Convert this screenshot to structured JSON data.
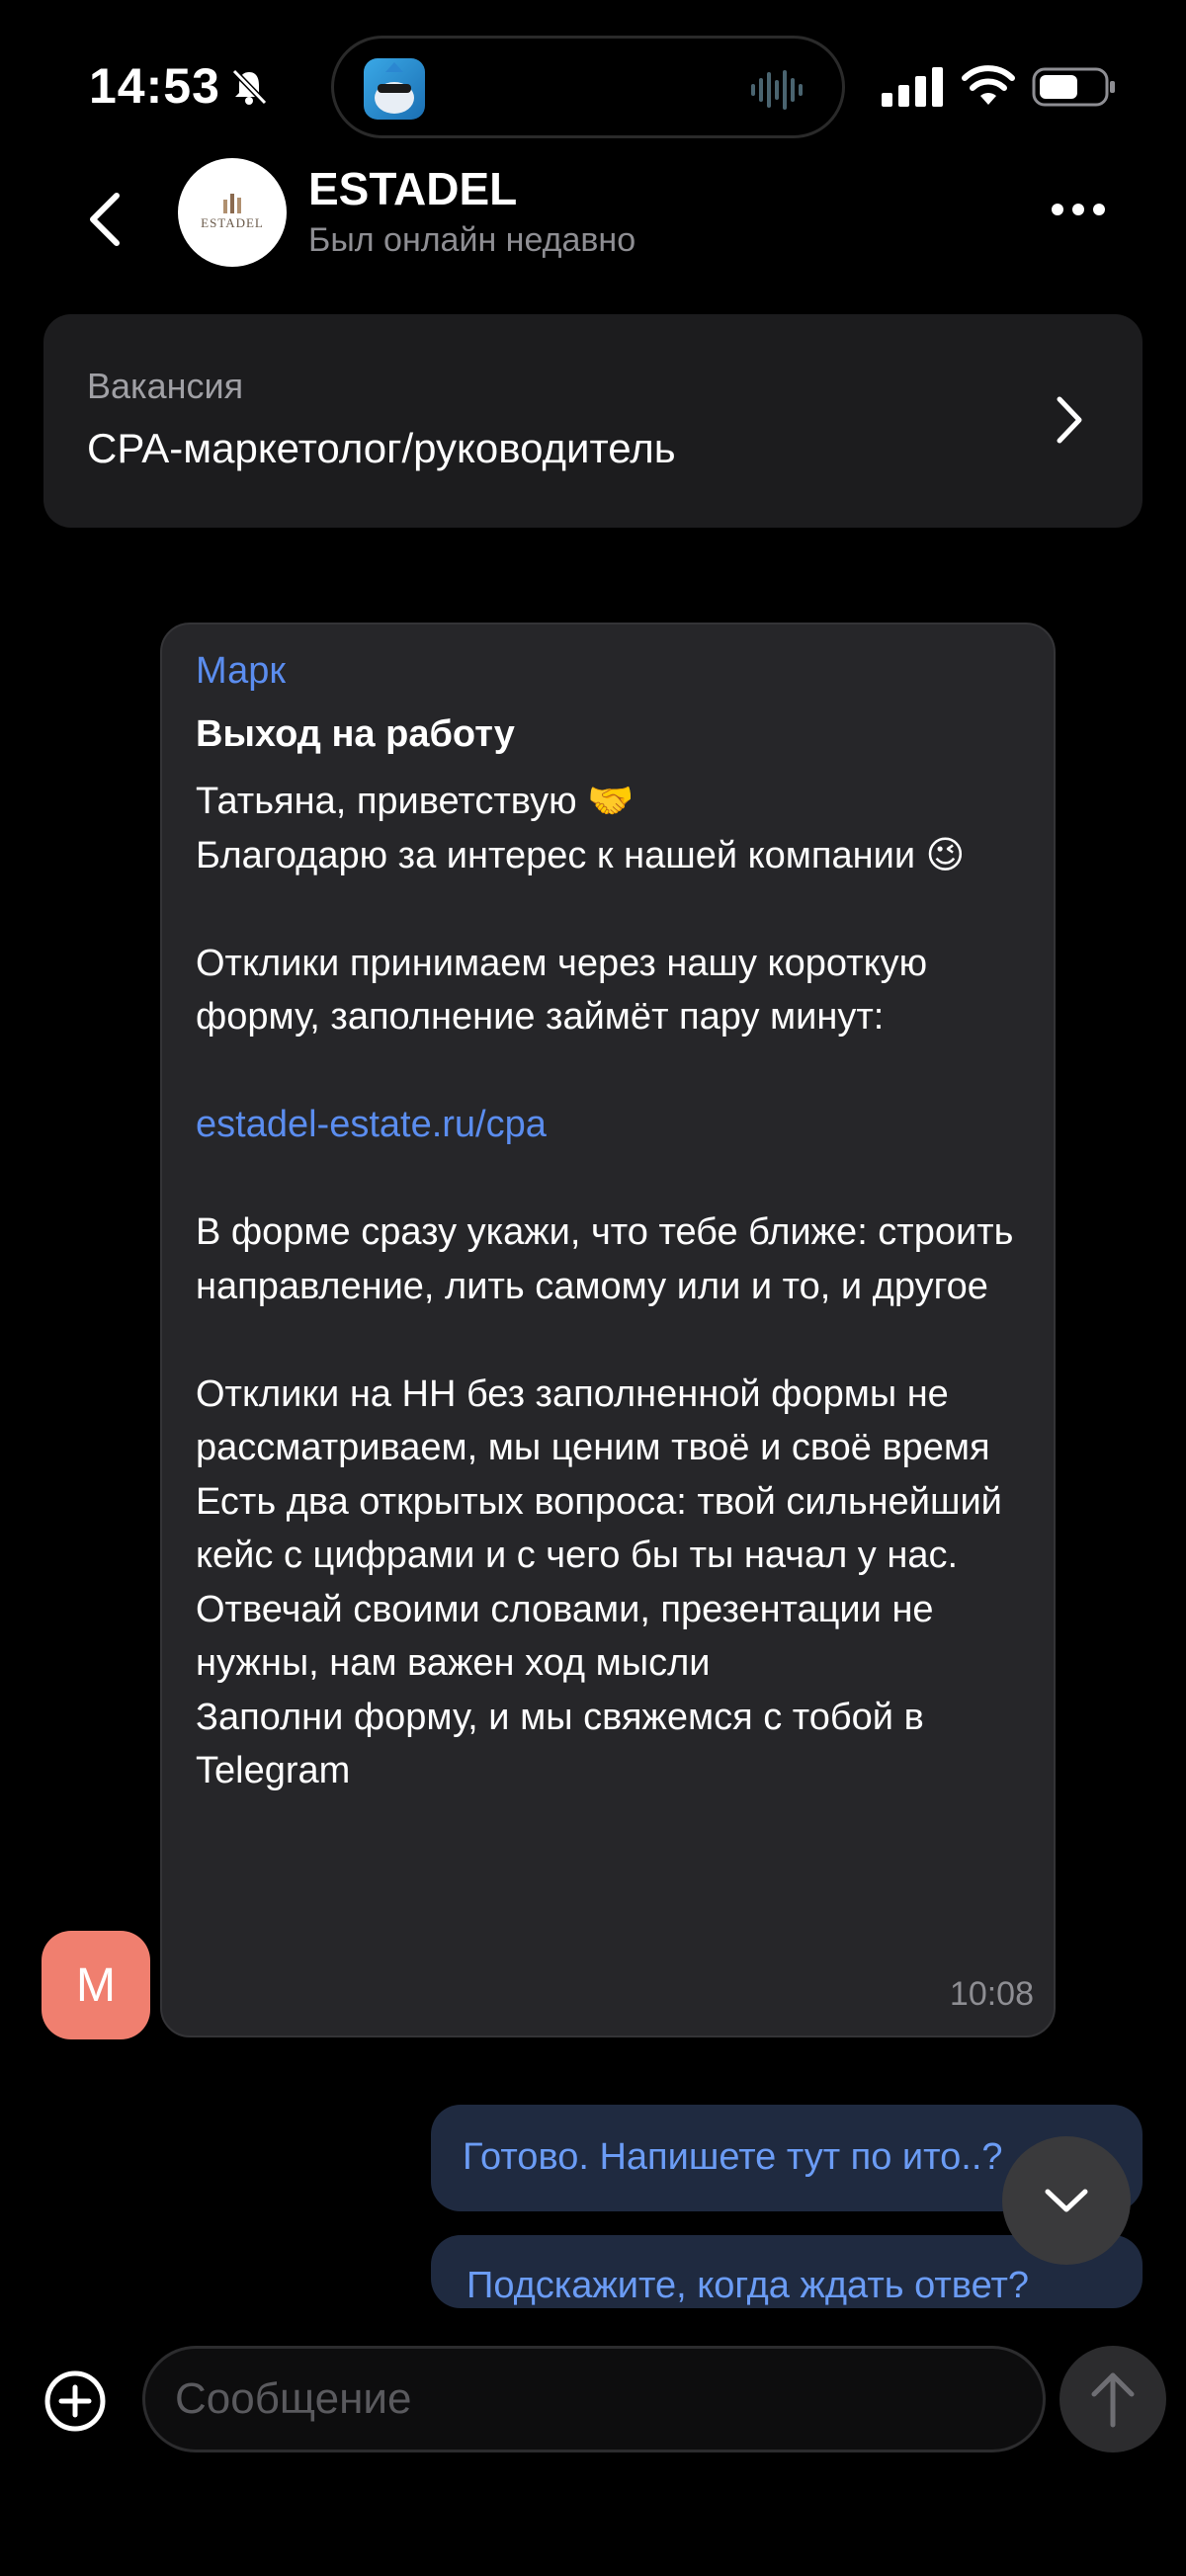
{
  "status_bar": {
    "time": "14:53",
    "icons": [
      "bell-off-icon",
      "app-icon",
      "audio-wave-icon",
      "signal-icon",
      "wifi-icon",
      "battery-icon"
    ]
  },
  "header": {
    "title": "ESTADEL",
    "subtitle": "Был онлайн недавно",
    "logo_text": "ESTADEL"
  },
  "vacancy": {
    "label": "Вакансия",
    "title": "CPA-маркетолог/руководитель"
  },
  "messages": {
    "incoming": {
      "sender": "Марк",
      "avatar_letter": "М",
      "title": "Выход на работу",
      "line1": "Татьяна, приветствую 🤝",
      "line2": "Благодарю за интерес к нашей компании 😉",
      "para2": "Отклики принимаем через нашу короткую форму, заполнение займёт пару минут:",
      "link": "estadel-estate.ru/cpa",
      "para3": "В форме сразу укажи, что тебе ближе: строить направление, лить самому или и то, и другое",
      "para4": "Отклики на HH без заполненной формы не рассматриваем, мы ценим твоё и своё время\nЕсть два открытых вопроса: твой сильнейший кейс с цифрами и с чего бы ты начал у нас.\nОтвечай своими словами, презентации не нужны, нам важен ход мысли\nЗаполни форму, и мы свяжемся с тобой в Telegram",
      "time": "10:08"
    },
    "outgoing": [
      {
        "text": "Готово. Напишете тут по ито..?"
      },
      {
        "text": "Подскажите, когда ждать ответ?"
      }
    ]
  },
  "composer": {
    "placeholder": "Сообщение"
  },
  "colors": {
    "accent": "#5b8def",
    "avatar": "#f07f6f",
    "bubble_in": "#262629",
    "bubble_out": "#1f2a40"
  }
}
